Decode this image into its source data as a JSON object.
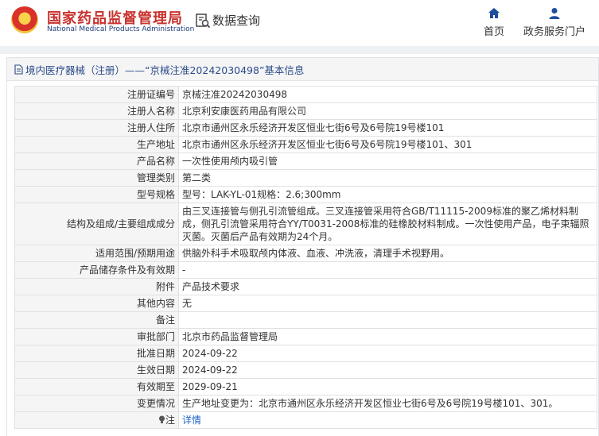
{
  "header": {
    "title": "国家药品监督管理局",
    "subtitle": "National Medical Products Administration",
    "search_label": "数据查询",
    "nav": [
      {
        "label": "首页",
        "icon": "home-icon"
      },
      {
        "label": "政务服务门户",
        "icon": "user-icon"
      }
    ]
  },
  "panel": {
    "breadcrumb": "境内医疗器械（注册）——“京械注准20242030498”基本信息"
  },
  "details": {
    "rows": [
      {
        "label": "注册证编号",
        "value": "京械注准20242030498"
      },
      {
        "label": "注册人名称",
        "value": "北京利安康医药用品有限公司"
      },
      {
        "label": "注册人住所",
        "value": "北京市通州区永乐经济开发区恒业七街6号及6号院19号楼101"
      },
      {
        "label": "生产地址",
        "value": "北京市通州区永乐经济开发区恒业七街6号及6号院19号楼101、301"
      },
      {
        "label": "产品名称",
        "value": "一次性使用颅内吸引管"
      },
      {
        "label": "管理类别",
        "value": "第二类"
      },
      {
        "label": "型号规格",
        "value": "型号：LAK-YL-01规格：2.6;300mm"
      },
      {
        "label": "结构及组成/主要组成成分",
        "value": "由三叉连接管与侧孔引流管组成。三叉连接管采用符合GB/T11115-2009标准的聚乙烯材料制成，侧孔引流管采用符合YY/T0031-2008标准的硅橡胶材料制成。一次性使用产品，电子束辐照灭菌。灭菌后产品有效期为24个月。"
      },
      {
        "label": "适用范围/预期用途",
        "value": "供脑外科手术吸取颅内体液、血液、冲洗液，清理手术视野用。"
      },
      {
        "label": "产品储存条件及有效期",
        "value": "-"
      },
      {
        "label": "附件",
        "value": "产品技术要求"
      },
      {
        "label": "其他内容",
        "value": "无"
      },
      {
        "label": "备注",
        "value": ""
      },
      {
        "label": "审批部门",
        "value": "北京市药品监督管理局"
      },
      {
        "label": "批准日期",
        "value": "2024-09-22"
      },
      {
        "label": "生效日期",
        "value": "2024-09-22"
      },
      {
        "label": "有效期至",
        "value": "2029-09-21"
      },
      {
        "label": "变更情况",
        "value": "生产地址变更为：北京市通州区永乐经济开发区恒业七街6号及6号院19号楼101、301。"
      }
    ],
    "note_label": "注",
    "note_link": "详情"
  }
}
